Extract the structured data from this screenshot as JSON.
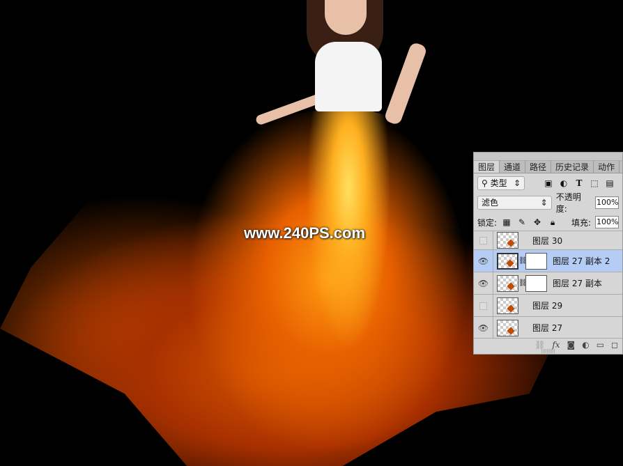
{
  "canvas": {
    "watermark": "www.240PS.com"
  },
  "panel": {
    "tabs": [
      "图层",
      "通道",
      "路径",
      "历史记录",
      "动作"
    ],
    "filter": {
      "label": "类型",
      "search_icon": "⚲"
    },
    "filter_icons": [
      "image-icon",
      "adjustment-icon",
      "text-icon",
      "shape-icon",
      "smart-object-icon"
    ],
    "blend_mode": "滤色",
    "opacity_label": "不透明度:",
    "opacity": "100%",
    "lock_label": "锁定:",
    "fill_label": "填充:",
    "fill": "100%",
    "layers": [
      {
        "name": "图层 30",
        "visible": false,
        "mask": false
      },
      {
        "name": "图层 27 副本 2",
        "visible": true,
        "mask": true,
        "selected": true
      },
      {
        "name": "图层 27 副本",
        "visible": true,
        "mask": true
      },
      {
        "name": "图层 29",
        "visible": false,
        "mask": false
      },
      {
        "name": "图层 27",
        "visible": true,
        "mask": false
      }
    ],
    "footer_fx": "fx"
  }
}
